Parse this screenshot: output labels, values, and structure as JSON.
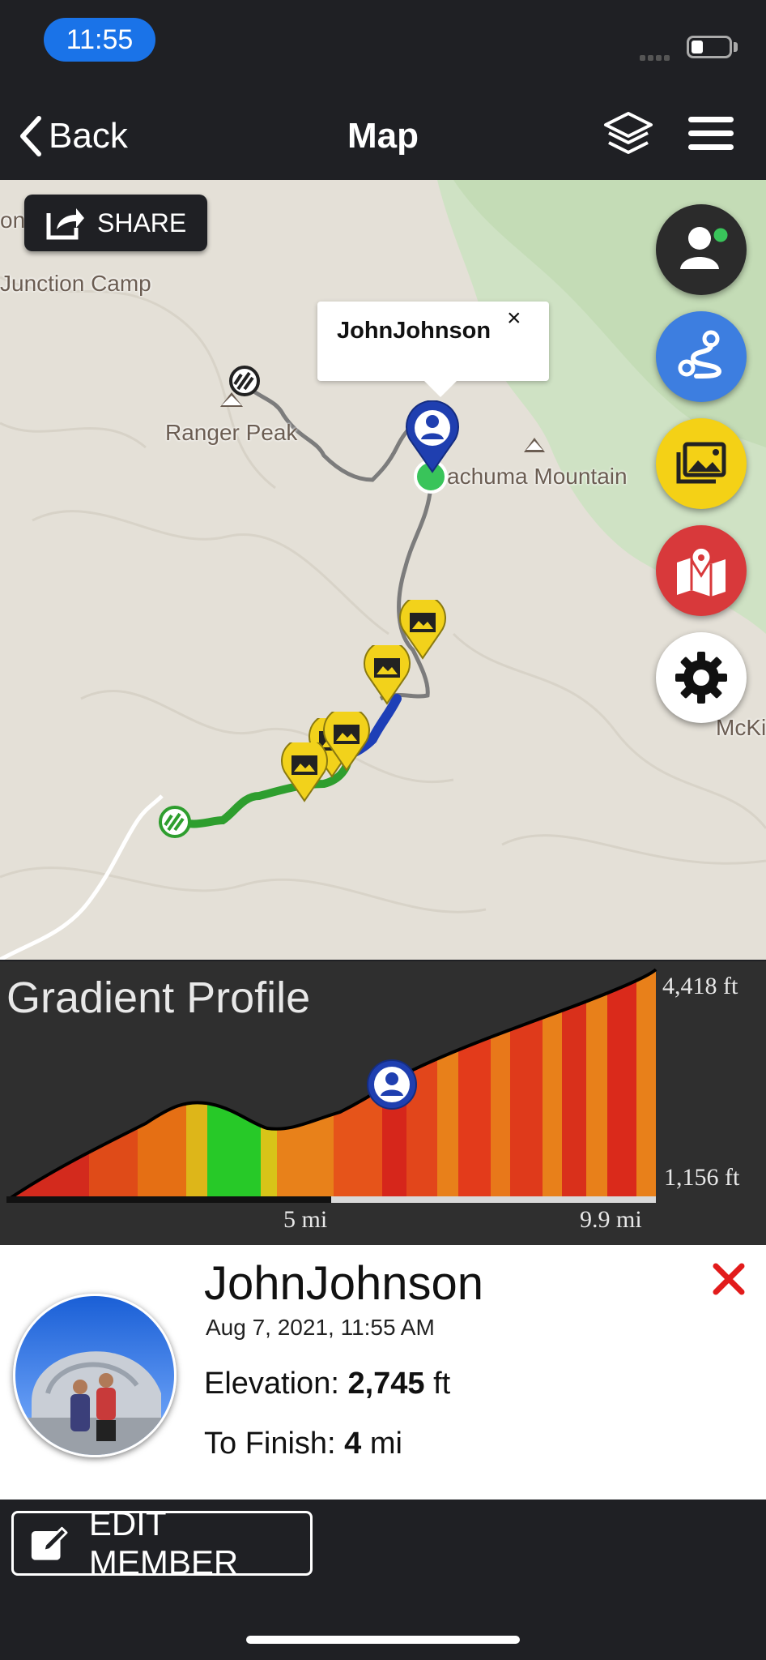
{
  "status_bar": {
    "time": "11:55"
  },
  "nav": {
    "back_label": "Back",
    "title": "Map"
  },
  "map": {
    "share_label": "SHARE",
    "labels": {
      "junction_camp": "Junction Camp",
      "ranger_peak": "Ranger Peak",
      "mountain": "achuma Mountain",
      "edge_left": "on",
      "edge_right": "McKi"
    },
    "popup": {
      "name": "JohnJohnson",
      "close": "×"
    },
    "fabs": [
      "members-icon",
      "route-icon",
      "photos-icon",
      "map-marker-icon",
      "settings-icon"
    ]
  },
  "gradient_profile": {
    "title": "Gradient Profile",
    "max_elevation": "4,418 ft",
    "min_elevation": "1,156 ft",
    "distance_mid": "5 mi",
    "distance_end": "9.9 mi",
    "progress_fraction": 0.5
  },
  "member": {
    "name": "JohnJohnson",
    "date": "Aug 7, 2021, 11:55 AM",
    "elevation_label": "Elevation: ",
    "elevation_value": "2,745",
    "elevation_unit": " ft",
    "finish_label": "To Finish: ",
    "finish_value": "4",
    "finish_unit": " mi"
  },
  "bottom": {
    "edit_label": "EDIT MEMBER"
  },
  "colors": {
    "dark_bg": "#1f2024",
    "time_pill": "#1a73e8",
    "fab_dark": "#2b2b2b",
    "fab_blue": "#3d7ee0",
    "fab_yellow": "#f4d116",
    "fab_red": "#d8393b",
    "close_red": "#e21b1b"
  }
}
